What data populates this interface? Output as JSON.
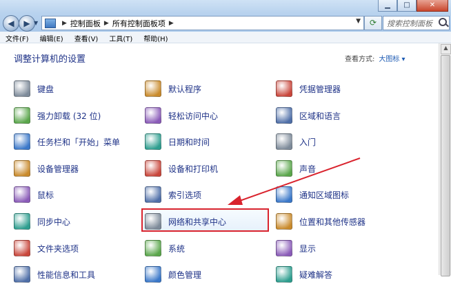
{
  "window": {
    "breadcrumb": [
      "控制面板",
      "所有控制面板项"
    ],
    "search_placeholder": "搜索控制面板",
    "buttons": {
      "minimize": "▁",
      "maximize": "□",
      "close": "✕"
    }
  },
  "menu": [
    "文件(F)",
    "编辑(E)",
    "查看(V)",
    "工具(T)",
    "帮助(H)"
  ],
  "header": {
    "title": "调整计算机的设置",
    "view_by_label": "查看方式:",
    "view_mode": "大图标 ▾"
  },
  "columns": [
    [
      "键盘",
      "强力卸载 (32 位)",
      "任务栏和「开始」菜单",
      "设备管理器",
      "鼠标",
      "同步中心",
      "文件夹选项",
      "性能信息和工具"
    ],
    [
      "默认程序",
      "轻松访问中心",
      "日期和时间",
      "设备和打印机",
      "索引选项",
      "网络和共享中心",
      "系统",
      "颜色管理"
    ],
    [
      "凭据管理器",
      "区域和语言",
      "入门",
      "声音",
      "通知区域图标",
      "位置和其他传感器",
      "显示",
      "疑难解答"
    ]
  ],
  "icons": [
    [
      "keyboard-icon",
      "uninstall-icon",
      "taskbar-icon",
      "device-manager-icon",
      "mouse-icon",
      "sync-center-icon",
      "folder-options-icon",
      "performance-icon"
    ],
    [
      "default-programs-icon",
      "ease-of-access-icon",
      "date-time-icon",
      "devices-printers-icon",
      "indexing-icon",
      "network-sharing-icon",
      "system-icon",
      "color-management-icon"
    ],
    [
      "credential-manager-icon",
      "region-language-icon",
      "getting-started-icon",
      "sound-icon",
      "notification-icons-icon",
      "location-sensors-icon",
      "display-icon",
      "troubleshooting-icon"
    ]
  ],
  "colors": {
    "accent_link": "#1e3287",
    "highlight_border": "#d9232d",
    "arrow": "#d9232d"
  }
}
